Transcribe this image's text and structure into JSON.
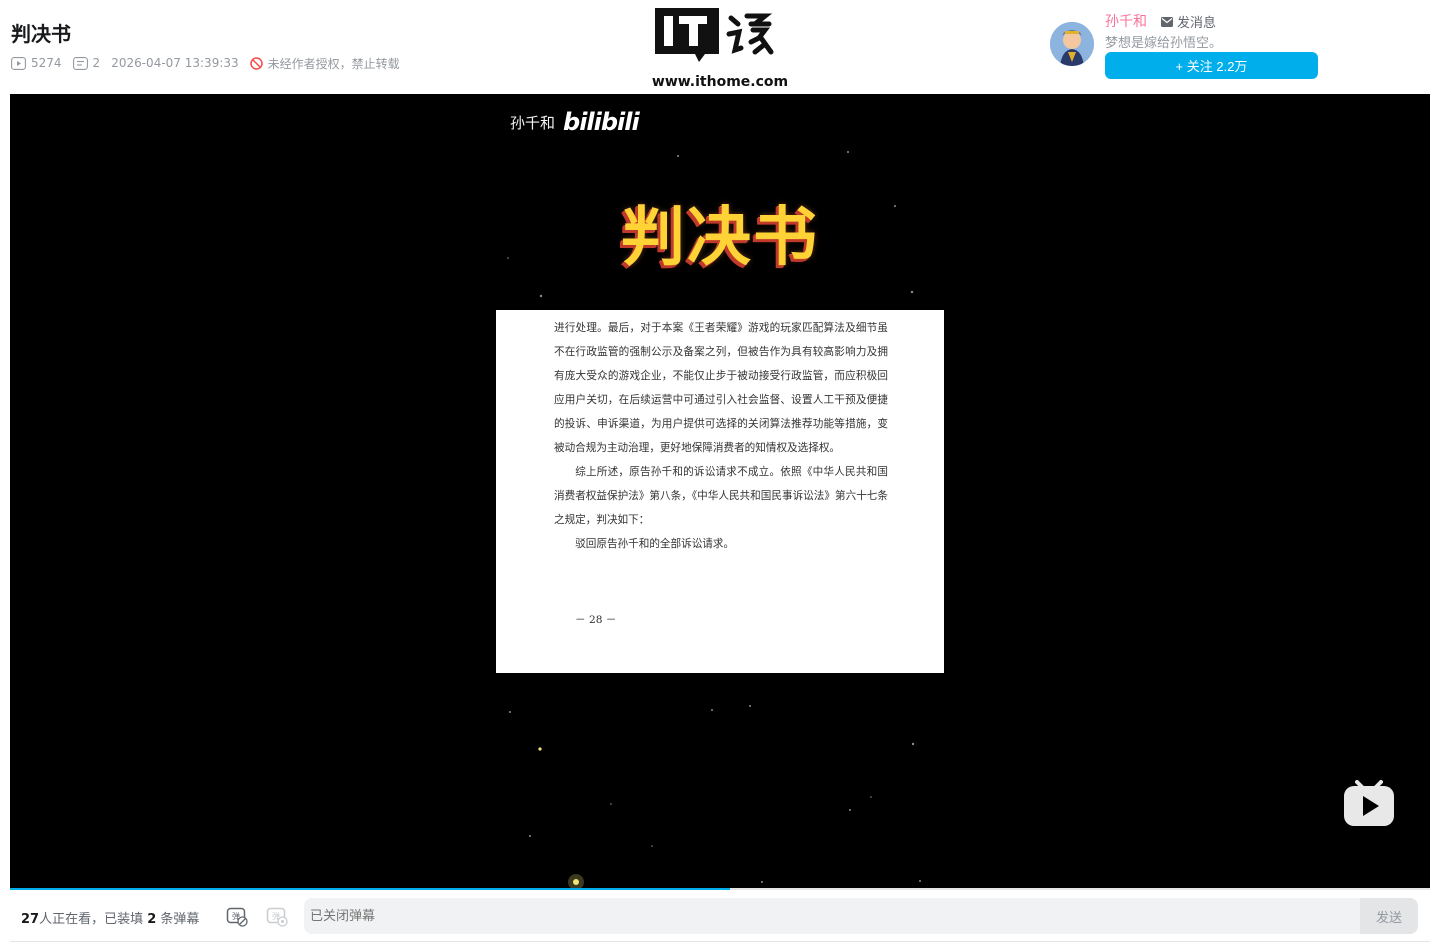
{
  "video": {
    "title": "判决书",
    "views": "5274",
    "danmaku_count": "2",
    "publish_time": "2026-04-07 13:39:33",
    "copyright": "未经作者授权，禁止转载"
  },
  "brand": {
    "logo_text": "IT之家",
    "url": "www.ithome.com"
  },
  "uploader": {
    "name": "孙千和",
    "message_label": "发消息",
    "signature": "梦想是嫁给孙悟空。",
    "follow_label": "+ 关注 2.2万"
  },
  "player": {
    "watermark_name": "孙千和",
    "watermark_brand": "bilibili",
    "frame_title": "判决书",
    "document": {
      "paragraph1": "进行处理。最后，对于本案《王者荣耀》游戏的玩家匹配算法及细节虽不在行政监管的强制公示及备案之列，但被告作为具有较高影响力及拥有庞大受众的游戏企业，不能仅止步于被动接受行政监管，而应积极回应用户关切，在后续运营中可通过引入社会监督、设置人工干预及便捷的投诉、申诉渠道，为用户提供可选择的关闭算法推荐功能等措施，变被动合规为主动治理，更好地保障消费者的知情权及选择权。",
      "paragraph2": "综上所述，原告孙千和的诉讼请求不成立。依照《中华人民共和国消费者权益保护法》第八条，《中华人民共和国民事诉讼法》第六十七条之规定，判决如下：",
      "paragraph3": "驳回原告孙千和的全部诉讼请求。",
      "page_number": "－ 28 －"
    },
    "progress": 0.507
  },
  "danmaku_bar": {
    "watching_count": "27",
    "watching_text": "人正在看，已装填 ",
    "loaded_count": "2",
    "loaded_text": " 条弹幕",
    "input_placeholder": "已关闭弹幕",
    "send_label": "发送"
  },
  "colors": {
    "accent": "#00aeec",
    "uploader_name": "#fb7299",
    "title_yellow": "#ffd236"
  }
}
